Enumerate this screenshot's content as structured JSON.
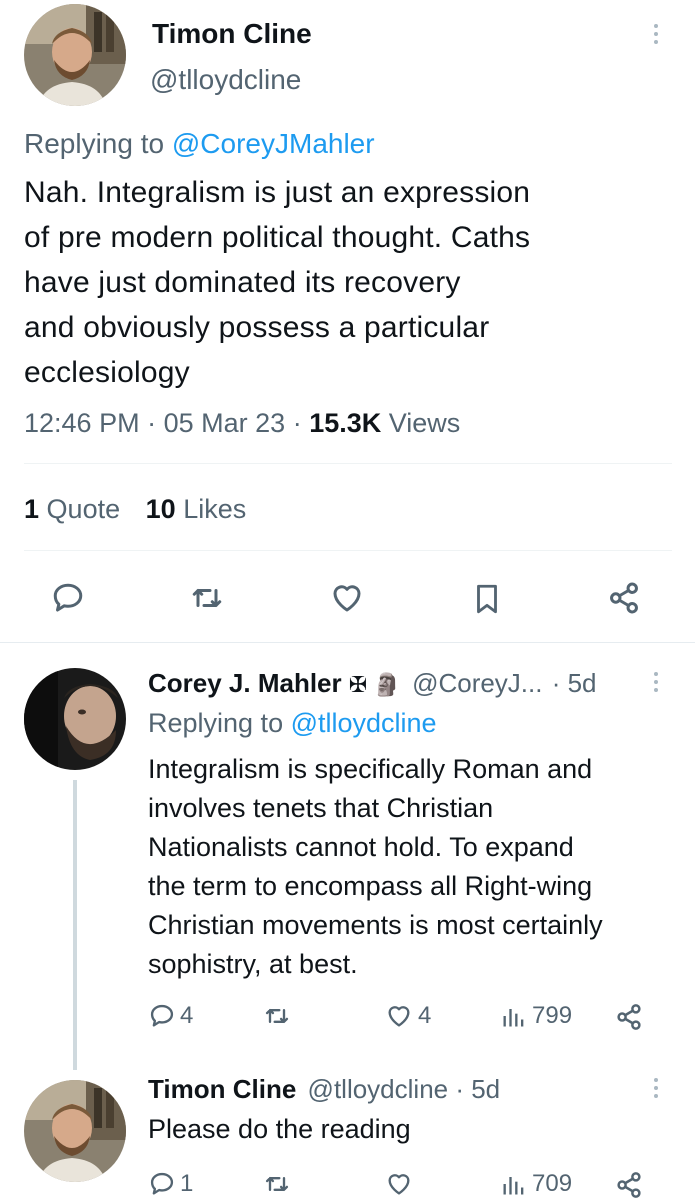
{
  "main_tweet": {
    "display_name": "Timon Cline",
    "handle": "@tlloydcline",
    "replying_prefix": "Replying to",
    "replying_to": "@CoreyJMahler",
    "text_lines": [
      "Nah. Integralism is just an expression",
      "of pre modern political thought. Caths",
      "have just dominated its recovery",
      "and obviously possess a particular",
      "ecclesiology"
    ],
    "time": "12:46 PM",
    "date": "05 Mar 23",
    "views_count": "15.3K",
    "views_label": "Views",
    "quote_count": "1",
    "quote_label": "Quote",
    "likes_count": "10",
    "likes_label": "Likes",
    "actions": [
      "reply-icon",
      "retweet-icon",
      "like-icon",
      "bookmark-icon",
      "share-icon"
    ]
  },
  "reply_1": {
    "display_name": "Corey J. Mahler",
    "name_emoji": "✠ 🗿",
    "handle": "@CoreyJ...",
    "age": "· 5d",
    "replying_prefix": "Replying to",
    "replying_to": "@tlloydcline",
    "text_lines": [
      "Integralism is specifically Roman and",
      "involves tenets that Christian",
      "Nationalists cannot hold. To expand",
      "the term to encompass all Right-wing",
      "Christian movements is most certainly",
      "sophistry, at best."
    ],
    "reply_count": "4",
    "retweet_count": "",
    "like_count": "4",
    "view_count": "799"
  },
  "reply_2": {
    "display_name": "Timon Cline",
    "handle": "@tlloydcline",
    "age": "· 5d",
    "text": "Please do the reading",
    "reply_count": "1",
    "retweet_count": "",
    "like_count": "",
    "view_count": "709"
  },
  "colors": {
    "text": "#0f1419",
    "muted": "#536471",
    "link": "#1d9bf0",
    "divider": "#eff3f4"
  }
}
